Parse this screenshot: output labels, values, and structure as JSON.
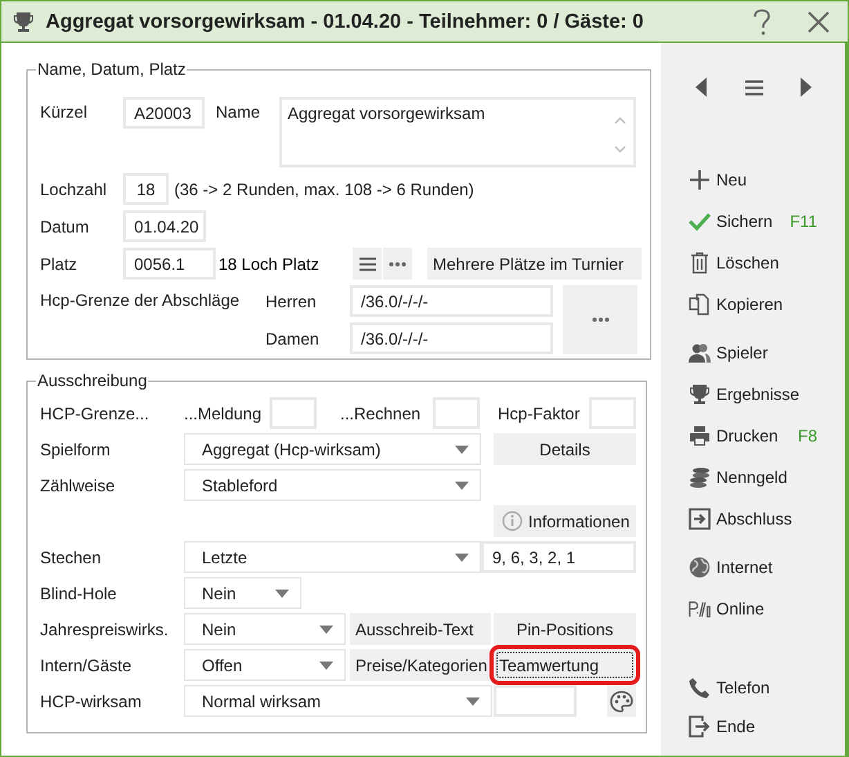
{
  "window": {
    "title": "Aggregat vorsorgewirksam - 01.04.20 - Teilnehmer: 0 / Gäste: 0"
  },
  "general": {
    "legend": "Name, Datum, Platz",
    "kuerzel": {
      "label": "Kürzel",
      "value": "A20003"
    },
    "name": {
      "label": "Name",
      "value": "Aggregat vorsorgewirksam"
    },
    "lochzahl": {
      "label": "Lochzahl",
      "value": "18",
      "hint": "(36 -> 2 Runden, max. 108 -> 6 Runden)"
    },
    "datum": {
      "label": "Datum",
      "value": "01.04.20"
    },
    "platz": {
      "label": "Platz",
      "value": "0056.1",
      "description": "18 Loch Platz",
      "button": "Mehrere Plätze im Turnier"
    },
    "hcp_limits": {
      "label": "Hcp-Grenze der Abschläge",
      "rows": [
        {
          "label": "Herren",
          "value": "/36.0/-/-/-"
        },
        {
          "label": "Damen",
          "value": "/36.0/-/-/-"
        }
      ]
    }
  },
  "ausschreibung": {
    "legend": "Ausschreibung",
    "hcp_grenze": {
      "label": "HCP-Grenze...",
      "fields": [
        {
          "label": "...Meldung"
        },
        {
          "label": "...Rechnen"
        },
        {
          "label": "Hcp-Faktor"
        }
      ]
    },
    "spielform": {
      "label": "Spielform",
      "value": "Aggregat (Hcp-wirksam)",
      "button": "Details"
    },
    "zaehlweise": {
      "label": "Zählweise",
      "value": "Stableford"
    },
    "info_button": "Informationen",
    "stechen": {
      "label": "Stechen",
      "value": "Letzte",
      "holes": "9, 6, 3, 2, 1"
    },
    "blind_hole": {
      "label": "Blind-Hole",
      "value": "Nein"
    },
    "jahrespreis": {
      "label": "Jahrespreiswirks.",
      "value": "Nein",
      "buttons": [
        {
          "label": "Ausschreib-Text",
          "highlighted": false
        },
        {
          "label": "Pin-Positions",
          "highlighted": false
        }
      ]
    },
    "intern": {
      "label": "Intern/Gäste",
      "value": "Offen",
      "buttons": [
        {
          "label": "Preise/Kategorien",
          "highlighted": false
        },
        {
          "label": "Teamwertung",
          "highlighted": true
        }
      ]
    },
    "hcp_wirksam": {
      "label": "HCP-wirksam",
      "value": "Normal wirksam"
    }
  },
  "sidebar": {
    "groups": [
      [
        {
          "label": "Neu"
        },
        {
          "label": "Sichern",
          "shortcut": "F11"
        },
        {
          "label": "Löschen"
        },
        {
          "label": "Kopieren"
        }
      ],
      [
        {
          "label": "Spieler"
        },
        {
          "label": "Ergebnisse"
        },
        {
          "label": "Drucken",
          "shortcut": "F8"
        },
        {
          "label": "Nenngeld"
        },
        {
          "label": "Abschluss"
        }
      ],
      [
        {
          "label": "Internet"
        },
        {
          "label": "Online"
        }
      ],
      [
        {
          "label": "Telefon"
        },
        {
          "label": "Ende"
        }
      ]
    ]
  }
}
